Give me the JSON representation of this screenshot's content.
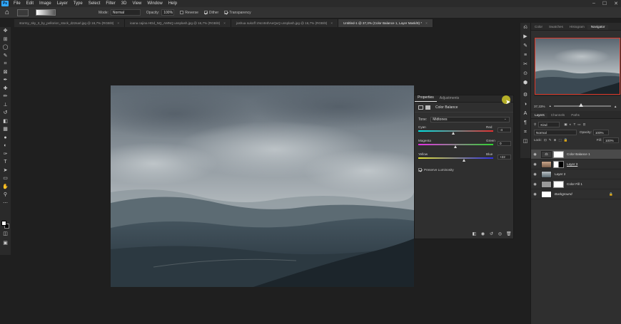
{
  "app": {
    "logo": "Ps"
  },
  "menu": [
    "File",
    "Edit",
    "Image",
    "Layer",
    "Type",
    "Select",
    "Filter",
    "3D",
    "View",
    "Window",
    "Help"
  ],
  "window_controls": {
    "minimize": "–",
    "maximize": "☐",
    "close": "✕"
  },
  "options_bar": {
    "mode_label": "Mode:",
    "mode_value": "Normal",
    "opacity_label": "Opacity:",
    "opacity_value": "100%",
    "reverse_label": "Reverse",
    "dither_label": "Dither",
    "transparency_label": "Transparency",
    "reverse_checked": false,
    "dither_checked": true,
    "transparency_checked": true
  },
  "tabs": [
    {
      "label": "stormy_sky_3_by_pellorion_stock_d22sarl.jpg @ 16,7% (RGB/8)",
      "close": "×"
    },
    {
      "label": "ioana cajina HDd_NQ_AMNQ unsplash.jpg @ 16,7% (RGB/8)",
      "close": "×"
    },
    {
      "label": "joshua sukoff 1Ncn94hAeQuQ unsplash.jpg @ 16,7% (RGB/8)",
      "close": "×"
    },
    {
      "label": "Untitled-1 @ 37,3% (Color Balance 1, Layer Mask/8) *",
      "close": "×"
    }
  ],
  "properties": {
    "tabs": [
      "Properties",
      "Adjustments"
    ],
    "close": "»",
    "title": "Color Balance",
    "tone_label": "Tone:",
    "tone_value": "Midtones",
    "sliders": [
      {
        "left": "Cyan",
        "right": "Red",
        "value": "-4",
        "level": 47
      },
      {
        "left": "Magenta",
        "right": "Green",
        "value": "0",
        "level": 50
      },
      {
        "left": "Yellow",
        "right": "Blue",
        "value": "+22",
        "level": 61
      }
    ],
    "preserve_label": "Preserve Luminosity",
    "preserve_checked": true
  },
  "right_panels": {
    "top_tabs": [
      "Color",
      "Swatches",
      "Histogram",
      "Navigator"
    ],
    "zoom_value": "37,33%",
    "zoom_level": 0.48,
    "layer_tabs": [
      "Layers",
      "Channels",
      "Paths"
    ],
    "kind_label": "Kind",
    "blend_mode": "Normal",
    "opacity_label": "Opacity:",
    "opacity_value": "100%",
    "lock_label": "Lock:",
    "fill_label": "Fill:",
    "fill_value": "100%",
    "layers": [
      {
        "name": "Color Balance 1",
        "selected": true
      },
      {
        "name": "Layer 3",
        "selected": false
      },
      {
        "name": "Layer 2",
        "selected": false
      },
      {
        "name": "Color Fill 1",
        "selected": false
      },
      {
        "name": "Background",
        "selected": false,
        "locked": true
      }
    ]
  },
  "colors": {
    "brand": "#31a8ff",
    "navigator_frame": "#e23a2a",
    "cursor_highlight": "#c4be28"
  }
}
